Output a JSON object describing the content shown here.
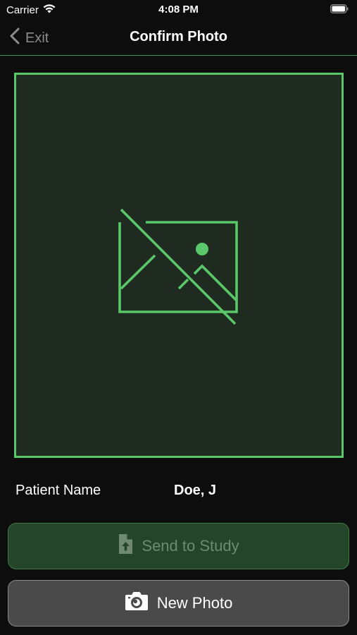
{
  "status_bar": {
    "carrier": "Carrier",
    "time": "4:08 PM"
  },
  "nav": {
    "back_label": "Exit",
    "title": "Confirm Photo"
  },
  "photo": {
    "placeholder_icon": "image-unavailable-icon"
  },
  "patient": {
    "label": "Patient Name",
    "value": "Doe, J"
  },
  "buttons": {
    "send_label": "Send to Study",
    "send_icon": "file-upload-icon",
    "new_photo_label": "New Photo",
    "new_photo_icon": "camera-icon"
  },
  "colors": {
    "accent": "#5ac86a",
    "frame_fill": "#1f2b20",
    "send_button_bg": "#24452a",
    "new_photo_button_bg": "#4a4a4a",
    "background": "#0d0d0d"
  }
}
